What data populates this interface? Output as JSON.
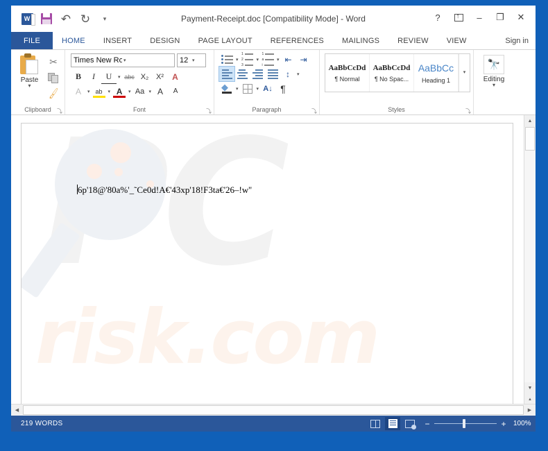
{
  "window": {
    "title": "Payment-Receipt.doc [Compatibility Mode] - Word",
    "help_label": "?",
    "ribbon_display_label": "",
    "minimize_label": "–",
    "maximize_label": "❐",
    "close_label": "✕",
    "signin_label": "Sign in"
  },
  "quick_access": {
    "app_logo_label": "W",
    "save_label": "Save",
    "undo_label": "↶",
    "redo_label": "↻",
    "customize_label": "▾"
  },
  "tabs": [
    {
      "label": "FILE"
    },
    {
      "label": "HOME"
    },
    {
      "label": "INSERT"
    },
    {
      "label": "DESIGN"
    },
    {
      "label": "PAGE LAYOUT"
    },
    {
      "label": "REFERENCES"
    },
    {
      "label": "MAILINGS"
    },
    {
      "label": "REVIEW"
    },
    {
      "label": "VIEW"
    }
  ],
  "ribbon": {
    "clipboard": {
      "group_label": "Clipboard",
      "paste_label": "Paste",
      "paste_caret": "▾",
      "cut_label": "✂",
      "copy_label": "Copy",
      "format_painter_label": "🖌",
      "launcher": "⤵"
    },
    "font": {
      "group_label": "Font",
      "font_name": "Times New Roman",
      "font_size": "12",
      "bold_label": "B",
      "italic_label": "I",
      "underline_label": "U",
      "strikethrough_label": "abc",
      "subscript_label": "X₂",
      "superscript_label": "X²",
      "clear_formatting_label": "A",
      "text_effects_label": "A",
      "highlight_label": "ab",
      "font_color_label": "A",
      "change_case_label": "Aa",
      "grow_font_label": "A",
      "shrink_font_label": "A",
      "caret": "▾",
      "launcher": "⤵"
    },
    "paragraph": {
      "group_label": "Paragraph",
      "bullets_label": "Bullets",
      "numbering_label": "Numbering",
      "multilevel_label": "Multilevel List",
      "decrease_indent_label": "⇤",
      "increase_indent_label": "⇥",
      "align_left_label": "Align Left",
      "align_center_label": "Center",
      "align_right_label": "Align Right",
      "justify_label": "Justify",
      "line_spacing_label": "↕",
      "shading_label": "Shading",
      "borders_label": "Borders",
      "sort_label": "A↓",
      "show_marks_label": "¶",
      "caret": "▾",
      "launcher": "⤵"
    },
    "styles": {
      "group_label": "Styles",
      "launcher": "⤵",
      "more_caret": "▾",
      "items": [
        {
          "preview": "AaBbCcDd",
          "name": "¶ Normal"
        },
        {
          "preview": "AaBbCcDd",
          "name": "¶ No Spac..."
        },
        {
          "preview": "AaBbCc",
          "name": "Heading 1"
        }
      ]
    },
    "editing": {
      "group_label": "Editing",
      "button_label": "Editing",
      "icon_label": "🔭",
      "caret": "▾"
    }
  },
  "document": {
    "body_text": "6p'18@'80a%'_˜Ce0d!A€'43xp'18!F3ta€'26–!w''",
    "watermark_top": "PC",
    "watermark_bottom": "risk.com"
  },
  "scrollbars": {
    "v_up": "▲",
    "v_down": "▼",
    "v_split": "▴",
    "h_left": "◀",
    "h_right": "▶"
  },
  "status": {
    "word_count": "219 WORDS",
    "read_mode_label": "Read Mode",
    "print_layout_label": "Print Layout",
    "web_layout_label": "Web Layout",
    "zoom_out_label": "−",
    "zoom_in_label": "+",
    "zoom_level": "100%"
  },
  "colors": {
    "accent": "#2b579a",
    "desktop": "#1060b8",
    "tab_active": "#2b579a",
    "selection": "#cde3f7"
  }
}
